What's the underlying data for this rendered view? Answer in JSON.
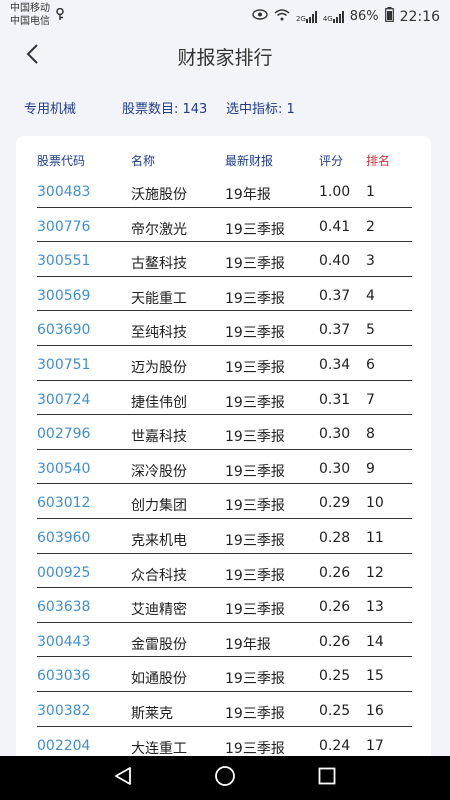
{
  "status_bar": {
    "carrier_1": "中国移动",
    "carrier_2": "中国电信",
    "net_tag_1": "2G",
    "net_tag_2": "4G",
    "battery": "86%",
    "time": "22:16"
  },
  "header": {
    "title": "财报家排行",
    "back_icon": "chevron-left-icon"
  },
  "info": {
    "industry": "专用机械",
    "stock_count": "股票数目: 143",
    "selected_indicators": "选中指标: 1"
  },
  "table": {
    "headers": {
      "code": "股票代码",
      "name": "名称",
      "report": "最新财报",
      "score": "评分",
      "rank": "排名"
    },
    "rows": [
      {
        "code": "300483",
        "name": "沃施股份",
        "report": "19年报",
        "score": "1.00",
        "rank": "1"
      },
      {
        "code": "300776",
        "name": "帝尔激光",
        "report": "19三季报",
        "score": "0.41",
        "rank": "2"
      },
      {
        "code": "300551",
        "name": "古鳌科技",
        "report": "19三季报",
        "score": "0.40",
        "rank": "3"
      },
      {
        "code": "300569",
        "name": "天能重工",
        "report": "19三季报",
        "score": "0.37",
        "rank": "4"
      },
      {
        "code": "603690",
        "name": "至纯科技",
        "report": "19三季报",
        "score": "0.37",
        "rank": "5"
      },
      {
        "code": "300751",
        "name": "迈为股份",
        "report": "19三季报",
        "score": "0.34",
        "rank": "6"
      },
      {
        "code": "300724",
        "name": "捷佳伟创",
        "report": "19三季报",
        "score": "0.31",
        "rank": "7"
      },
      {
        "code": "002796",
        "name": "世嘉科技",
        "report": "19三季报",
        "score": "0.30",
        "rank": "8"
      },
      {
        "code": "300540",
        "name": "深冷股份",
        "report": "19三季报",
        "score": "0.30",
        "rank": "9"
      },
      {
        "code": "603012",
        "name": "创力集团",
        "report": "19三季报",
        "score": "0.29",
        "rank": "10"
      },
      {
        "code": "603960",
        "name": "克来机电",
        "report": "19三季报",
        "score": "0.28",
        "rank": "11"
      },
      {
        "code": "000925",
        "name": "众合科技",
        "report": "19三季报",
        "score": "0.26",
        "rank": "12"
      },
      {
        "code": "603638",
        "name": "艾迪精密",
        "report": "19三季报",
        "score": "0.26",
        "rank": "13"
      },
      {
        "code": "300443",
        "name": "金雷股份",
        "report": "19年报",
        "score": "0.26",
        "rank": "14"
      },
      {
        "code": "603036",
        "name": "如通股份",
        "report": "19三季报",
        "score": "0.25",
        "rank": "15"
      },
      {
        "code": "300382",
        "name": "斯莱克",
        "report": "19三季报",
        "score": "0.25",
        "rank": "16"
      },
      {
        "code": "002204",
        "name": "大连重工",
        "report": "19三季报",
        "score": "0.24",
        "rank": "17"
      }
    ]
  },
  "nav_bar": {
    "back_icon": "triangle-back-icon",
    "home_icon": "circle-home-icon",
    "recents_icon": "square-recents-icon"
  },
  "colors": {
    "background": "#f2f4fa",
    "accent_blue": "#1e3c8c",
    "code_blue": "#3f8fd2",
    "rank_red": "#d8303a"
  }
}
